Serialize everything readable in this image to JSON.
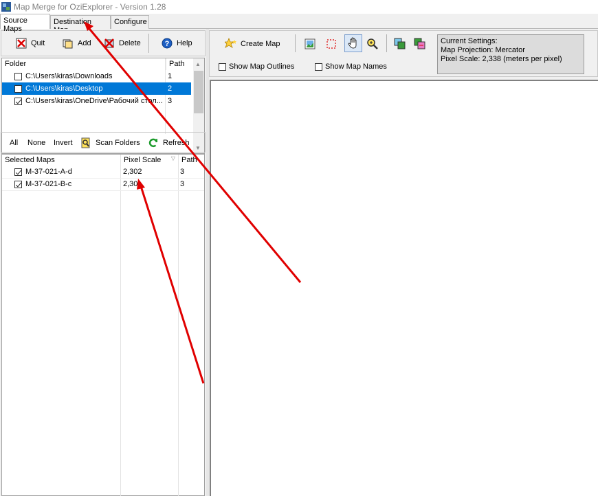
{
  "window": {
    "title": "Map Merge for OziExplorer - Version 1.28"
  },
  "tabs": [
    {
      "label": "Source Maps",
      "active": true
    },
    {
      "label": "Destination Map",
      "active": false
    },
    {
      "label": "Configure",
      "active": false
    }
  ],
  "toolbar_left": {
    "quit": "Quit",
    "add": "Add",
    "delete": "Delete",
    "help": "Help"
  },
  "folders": {
    "headers": {
      "folder": "Folder",
      "path": "Path"
    },
    "rows": [
      {
        "folder": "C:\\Users\\kiras\\Downloads",
        "path": "1",
        "checked": false,
        "selected": false
      },
      {
        "folder": "C:\\Users\\kiras\\Desktop",
        "path": "2",
        "checked": false,
        "selected": true
      },
      {
        "folder": "C:\\Users\\kiras\\OneDrive\\Рабочий стол...",
        "path": "3",
        "checked": true,
        "selected": false
      }
    ]
  },
  "toolbar_maps": {
    "all": "All",
    "none": "None",
    "invert": "Invert",
    "scan": "Scan Folders",
    "refresh": "Refresh"
  },
  "maps": {
    "headers": {
      "name": "Selected Maps",
      "scale": "Pixel Scale",
      "path": "Path"
    },
    "rows": [
      {
        "name": "M-37-021-A-d",
        "scale": "2,302",
        "path": "3",
        "checked": true
      },
      {
        "name": "M-37-021-B-c",
        "scale": "2,30",
        "path": "3",
        "checked": true
      }
    ]
  },
  "toolbar_right": {
    "create_map": "Create Map"
  },
  "options": {
    "show_outlines": "Show Map Outlines",
    "show_names": "Show Map Names"
  },
  "settings": {
    "heading": "Current Settings:",
    "projection": "Map Projection: Mercator",
    "pixel_scale": "Pixel Scale: 2,338 (meters per pixel)"
  },
  "colors": {
    "selection": "#0078d7",
    "annotation_arrow": "#e00000"
  }
}
